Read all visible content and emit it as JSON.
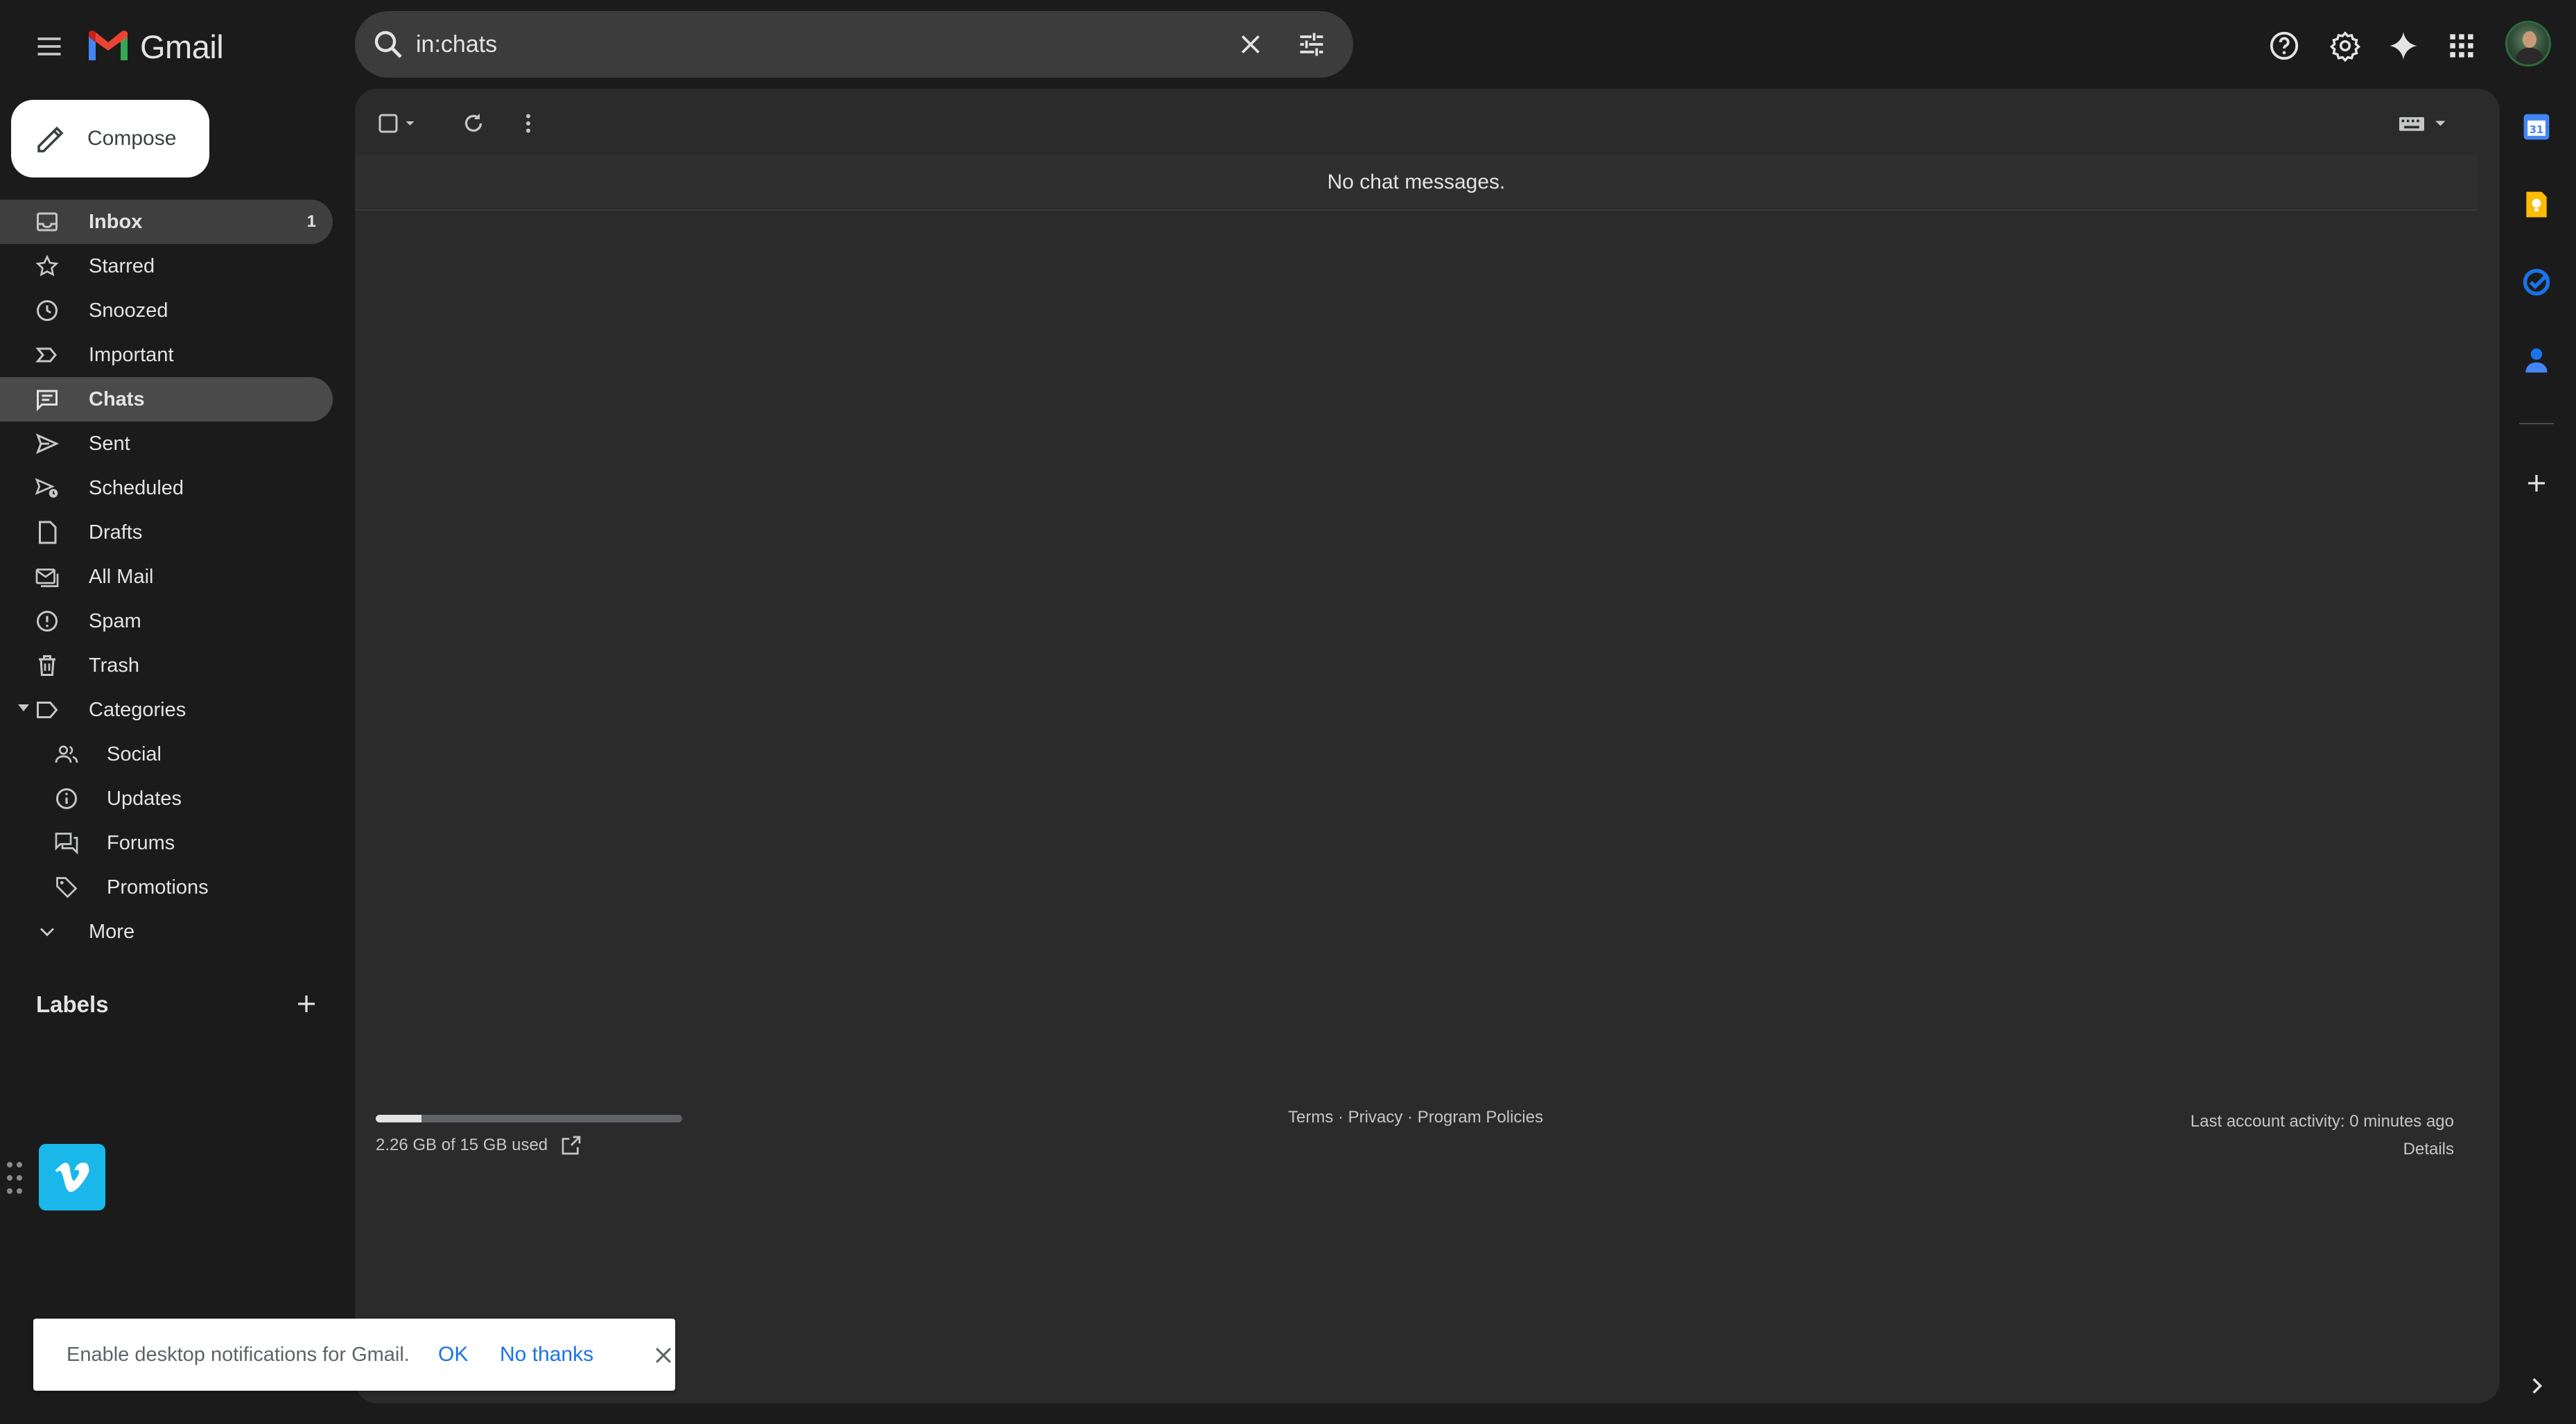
{
  "app": {
    "name": "Gmail"
  },
  "search": {
    "value": "in:chats"
  },
  "compose": {
    "label": "Compose"
  },
  "nav": {
    "items": [
      {
        "label": "Inbox",
        "count": "1"
      },
      {
        "label": "Starred"
      },
      {
        "label": "Snoozed"
      },
      {
        "label": "Important"
      },
      {
        "label": "Chats"
      },
      {
        "label": "Sent"
      },
      {
        "label": "Scheduled"
      },
      {
        "label": "Drafts"
      },
      {
        "label": "All Mail"
      },
      {
        "label": "Spam"
      },
      {
        "label": "Trash"
      },
      {
        "label": "Categories"
      },
      {
        "label": "Social"
      },
      {
        "label": "Updates"
      },
      {
        "label": "Forums"
      },
      {
        "label": "Promotions"
      },
      {
        "label": "More"
      }
    ],
    "labels_heading": "Labels"
  },
  "main": {
    "empty_message": "No chat messages.",
    "storage": {
      "text": "2.26 GB of 15 GB used",
      "fraction": 0.15
    },
    "footer": {
      "terms": "Terms",
      "privacy": "Privacy",
      "policies": "Program Policies",
      "sep": " · "
    },
    "activity": {
      "text": "Last account activity: 0 minutes ago",
      "details": "Details"
    }
  },
  "notification": {
    "message": "Enable desktop notifications for Gmail.",
    "ok": "OK",
    "no_thanks": "No thanks"
  },
  "colors": {
    "background": "#1b1b1b",
    "panel": "#2b2b2b",
    "link_blue": "#1a73e8",
    "vimeo": "#1ab7ea"
  }
}
